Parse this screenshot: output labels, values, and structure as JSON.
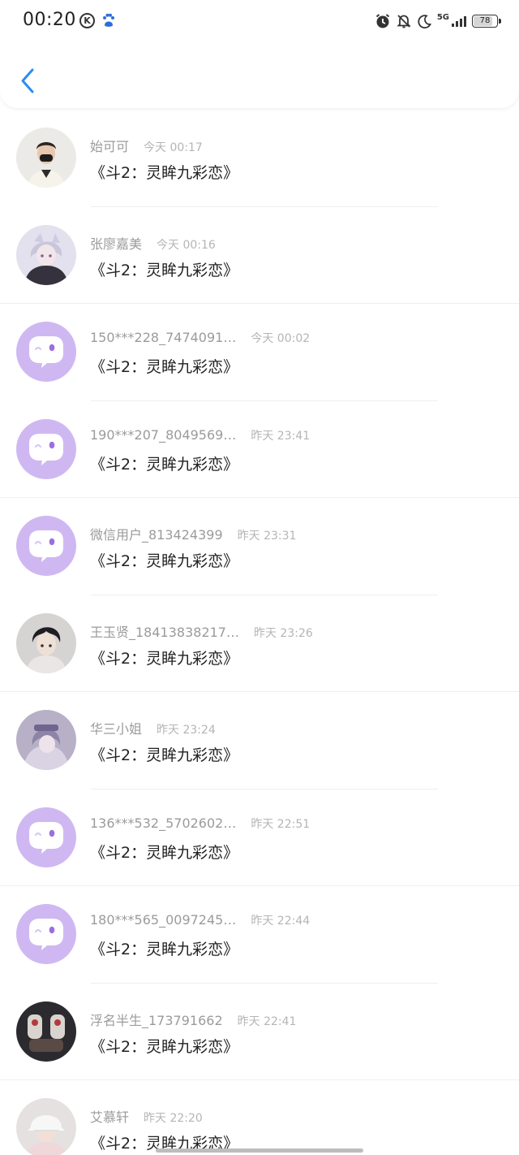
{
  "status_bar": {
    "time": "00:20",
    "k_icon_letter": "K",
    "network": "5G",
    "battery": "78",
    "battery_level": 0.78
  },
  "header": {
    "back_icon": "chevron-left-icon",
    "accent": "#2a8ef0"
  },
  "comments": [
    {
      "name": "始可可",
      "time": "今天 00:17",
      "content": "《斗2：灵眸九彩恋》",
      "avatar": "photo"
    },
    {
      "name": "张廖嘉美",
      "time": "今天 00:16",
      "content": "《斗2：灵眸九彩恋》",
      "avatar": "photo"
    },
    {
      "name": "150***228_7474091…",
      "time": "今天 00:02",
      "content": "《斗2：灵眸九彩恋》",
      "avatar": "default-chat"
    },
    {
      "name": "190***207_8049569…",
      "time": "昨天 23:41",
      "content": "《斗2：灵眸九彩恋》",
      "avatar": "default-chat"
    },
    {
      "name": "微信用户_813424399",
      "time": "昨天 23:31",
      "content": "《斗2：灵眸九彩恋》",
      "avatar": "default-chat"
    },
    {
      "name": "王玉贤_18413838217…",
      "time": "昨天 23:26",
      "content": "《斗2：灵眸九彩恋》",
      "avatar": "photo"
    },
    {
      "name": "华三小姐",
      "time": "昨天 23:24",
      "content": "《斗2：灵眸九彩恋》",
      "avatar": "photo"
    },
    {
      "name": "136***532_5702602…",
      "time": "昨天 22:51",
      "content": "《斗2：灵眸九彩恋》",
      "avatar": "default-chat"
    },
    {
      "name": "180***565_0097245…",
      "time": "昨天 22:44",
      "content": "《斗2：灵眸九彩恋》",
      "avatar": "default-chat"
    },
    {
      "name": "浮名半生_173791662",
      "time": "昨天 22:41",
      "content": "《斗2：灵眸九彩恋》",
      "avatar": "photo"
    },
    {
      "name": "艾慕轩",
      "time": "昨天 22:20",
      "content": "《斗2：灵眸九彩恋》",
      "avatar": "photo"
    }
  ],
  "colors": {
    "default_avatar_bg": "#cfb8f2",
    "default_avatar_eye": "#9a6fe0",
    "name_text": "#9b9b9b",
    "time_text": "#b5b5b5",
    "content_text": "#222222"
  }
}
